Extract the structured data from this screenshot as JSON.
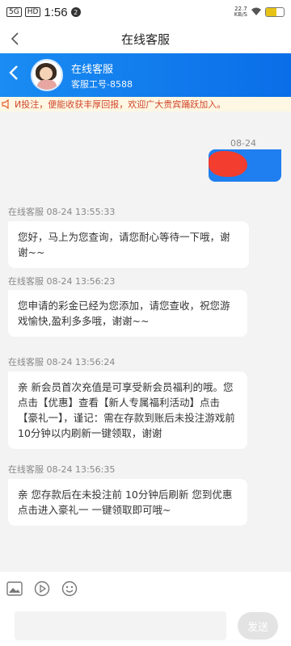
{
  "status_bar": {
    "network": "5G",
    "hd": "HD",
    "time": "1:56",
    "notification_count": "2",
    "speed_value": "22.7",
    "speed_unit": "KB/S",
    "battery_level": 0.6
  },
  "nav": {
    "title": "在线客服"
  },
  "agent": {
    "name": "在线客服",
    "id_label": "客服工号-8588"
  },
  "announcement": {
    "text": "И投注，便能收获丰厚回报，欢迎广大贵宾踊跃加入。"
  },
  "messages": [
    {
      "type": "sent",
      "time": "08-24 13:55:15"
    },
    {
      "type": "received",
      "sender": "在线客服 08-24 13:55:33",
      "text": "您好，马上为您查询，请您耐心等待一下哦，谢谢~~"
    },
    {
      "type": "received",
      "sender": "在线客服 08-24 13:56:23",
      "text": "您申请的彩金已经为您添加，请您查收，祝您游戏愉快,盈利多多哦，谢谢~~"
    },
    {
      "type": "received",
      "sender": "在线客服 08-24 13:56:24",
      "text": "亲 新会员首次充值是可享受新会员福利的哦。您点击【优惠】查看【新人专属福利活动】点击【豪礼一】，谨记：需在存款到账后未投注游戏前 10分钟以内刷新一键领取，谢谢"
    },
    {
      "type": "received",
      "sender": "在线客服 08-24 13:56:35",
      "text": "亲 您存款后在未投注前 10分钟后刷新 您到优惠点击进入豪礼一 一键领取即可哦~"
    }
  ],
  "composer": {
    "input_value": "",
    "send_label": "发送"
  },
  "icons": {
    "image": "image-icon",
    "play": "play-icon",
    "emoji": "emoji-icon"
  },
  "colors": {
    "header_blue": "#1a8cf2",
    "sent_bubble": "#1f7ef0",
    "announcement_text": "#d2462a"
  }
}
